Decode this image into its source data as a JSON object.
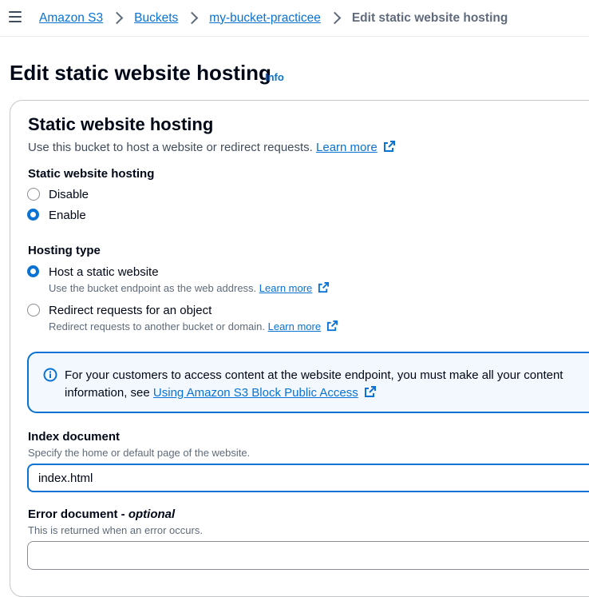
{
  "breadcrumb": {
    "items": [
      "Amazon S3",
      "Buckets",
      "my-bucket-practicee"
    ],
    "current": "Edit static website hosting"
  },
  "page": {
    "title": "Edit static website hosting",
    "info": "Info"
  },
  "section": {
    "title": "Static website hosting",
    "description": "Use this bucket to host a website or redirect requests.",
    "learn_more": "Learn more"
  },
  "hosting": {
    "label": "Static website hosting",
    "options": [
      "Disable",
      "Enable"
    ],
    "selected": "Enable"
  },
  "hosting_type": {
    "label": "Hosting type",
    "options": [
      {
        "label": "Host a static website",
        "desc": "Use the bucket endpoint as the web address.",
        "learn_more": "Learn more"
      },
      {
        "label": "Redirect requests for an object",
        "desc": "Redirect requests to another bucket or domain.",
        "learn_more": "Learn more"
      }
    ],
    "selected": "Host a static website"
  },
  "alert": {
    "line1": "For your customers to access content at the website endpoint, you must make all your content",
    "line2_prefix": "information, see",
    "link": "Using Amazon S3 Block Public Access"
  },
  "index_document": {
    "label": "Index document",
    "desc": "Specify the home or default page of the website.",
    "value": "index.html"
  },
  "error_document": {
    "label": "Error document",
    "optional": "optional",
    "desc": "This is returned when an error occurs."
  },
  "colors": {
    "accent": "#0972d3",
    "alert_bg": "#f2f8fd"
  }
}
